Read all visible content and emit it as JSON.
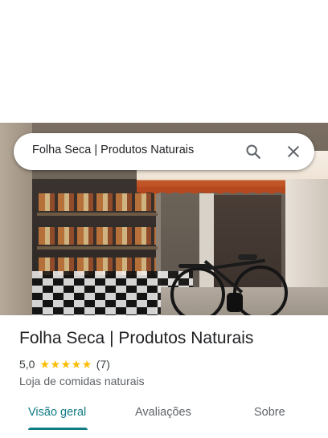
{
  "search": {
    "query": "Folha Seca | Produtos Naturais"
  },
  "place": {
    "name": "Folha Seca | Produtos Naturais",
    "rating": "5,0",
    "stars": 5,
    "review_count": "(7)",
    "category": "Loja de comidas naturais"
  },
  "tabs": [
    {
      "label": "Visão geral",
      "active": true
    },
    {
      "label": "Avaliações",
      "active": false
    },
    {
      "label": "Sobre",
      "active": false
    }
  ],
  "colors": {
    "accent": "#0f7b85",
    "star": "#fbbc04"
  },
  "icons": {
    "search": "search-icon",
    "close": "close-icon"
  }
}
